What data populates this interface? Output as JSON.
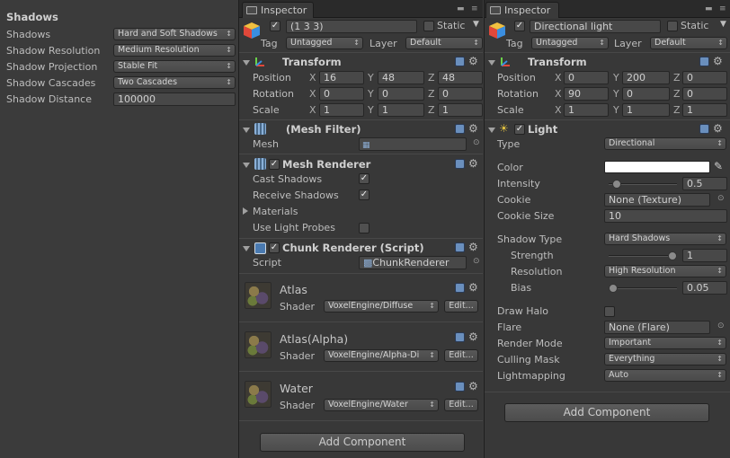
{
  "quality": {
    "title": "Shadows",
    "rows": [
      {
        "label": "Shadows",
        "value": "Hard and Soft Shadows",
        "kind": "drop"
      },
      {
        "label": "Shadow Resolution",
        "value": "Medium Resolution",
        "kind": "drop"
      },
      {
        "label": "Shadow Projection",
        "value": "Stable Fit",
        "kind": "drop"
      },
      {
        "label": "Shadow Cascades",
        "value": "Two Cascades",
        "kind": "drop"
      },
      {
        "label": "Shadow Distance",
        "value": "100000",
        "kind": "field"
      }
    ]
  },
  "inspector1": {
    "tab": "Inspector",
    "object_name": "(1 3 3)",
    "static_label": "Static",
    "tag_label": "Tag",
    "tag_value": "Untagged",
    "layer_label": "Layer",
    "layer_value": "Default",
    "transform": {
      "title": "Transform",
      "position": {
        "label": "Position",
        "x": "16",
        "y": "48",
        "z": "48"
      },
      "rotation": {
        "label": "Rotation",
        "x": "0",
        "y": "0",
        "z": "0"
      },
      "scale": {
        "label": "Scale",
        "x": "1",
        "y": "1",
        "z": "1"
      }
    },
    "mesh_filter": {
      "title": "(Mesh Filter)",
      "mesh_label": "Mesh",
      "mesh_value": ""
    },
    "mesh_renderer": {
      "title": "Mesh Renderer",
      "cast_shadows": "Cast Shadows",
      "receive_shadows": "Receive Shadows",
      "materials": "Materials",
      "use_light_probes": "Use Light Probes"
    },
    "chunk_renderer": {
      "title": "Chunk Renderer (Script)",
      "script_label": "Script",
      "script_value": "ChunkRenderer"
    },
    "materials": [
      {
        "name": "Atlas",
        "shader_label": "Shader",
        "shader": "VoxelEngine/Diffuse",
        "edit": "Edit..."
      },
      {
        "name": "Atlas(Alpha)",
        "shader_label": "Shader",
        "shader": "VoxelEngine/Alpha-Di",
        "edit": "Edit..."
      },
      {
        "name": "Water",
        "shader_label": "Shader",
        "shader": "VoxelEngine/Water",
        "edit": "Edit..."
      }
    ],
    "add_component": "Add Component"
  },
  "inspector2": {
    "tab": "Inspector",
    "object_name": "Directional light",
    "static_label": "Static",
    "tag_label": "Tag",
    "tag_value": "Untagged",
    "layer_label": "Layer",
    "layer_value": "Default",
    "transform": {
      "title": "Transform",
      "position": {
        "label": "Position",
        "x": "0",
        "y": "200",
        "z": "0"
      },
      "rotation": {
        "label": "Rotation",
        "x": "90",
        "y": "0",
        "z": "0"
      },
      "scale": {
        "label": "Scale",
        "x": "1",
        "y": "1",
        "z": "1"
      }
    },
    "light": {
      "title": "Light",
      "type_label": "Type",
      "type_value": "Directional",
      "color_label": "Color",
      "color_value": "#ffffff",
      "intensity_label": "Intensity",
      "intensity_value": "0.5",
      "intensity_fraction": 0.0625,
      "cookie_label": "Cookie",
      "cookie_value": "None (Texture)",
      "cookie_size_label": "Cookie Size",
      "cookie_size_value": "10",
      "shadow_type_label": "Shadow Type",
      "shadow_type_value": "Hard Shadows",
      "strength_label": "Strength",
      "strength_value": "1",
      "strength_fraction": 1.0,
      "resolution_label": "Resolution",
      "resolution_value": "High Resolution",
      "bias_label": "Bias",
      "bias_value": "0.05",
      "bias_fraction": 0.0,
      "draw_halo_label": "Draw Halo",
      "flare_label": "Flare",
      "flare_value": "None (Flare)",
      "render_mode_label": "Render Mode",
      "render_mode_value": "Important",
      "culling_mask_label": "Culling Mask",
      "culling_mask_value": "Everything",
      "lightmapping_label": "Lightmapping",
      "lightmapping_value": "Auto"
    },
    "add_component": "Add Component"
  },
  "axis": {
    "x": "X",
    "y": "Y",
    "z": "Z"
  },
  "colors": {
    "panel_bg": "#383838",
    "field_bg": "#484848",
    "help_icon": "#6a8fbd",
    "light_icon": "#e0c040"
  }
}
